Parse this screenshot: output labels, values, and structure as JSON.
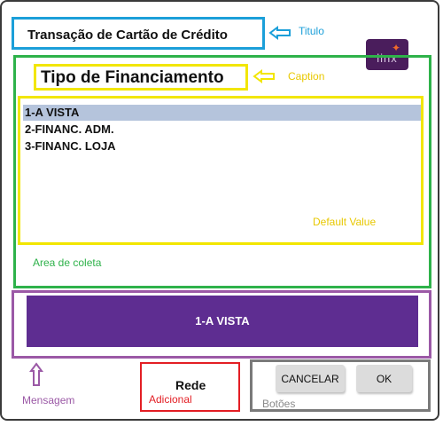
{
  "window": {
    "title": "Transação de Cartão de Crédito",
    "logo": "Linx"
  },
  "annotations": {
    "titulo": "Titulo",
    "caption": "Caption",
    "default_value": "Default Value",
    "area_coleta": "Area de coleta",
    "mensagem": "Mensagem",
    "adicional": "Adicional",
    "botoes": "Botões"
  },
  "prompt": {
    "caption": "Tipo de Financiamento",
    "options": [
      "1-A VISTA",
      "2-FINANC. ADM.",
      "3-FINANC. LOJA"
    ],
    "selected_index": 0
  },
  "value_display": "1-A VISTA",
  "rede": {
    "title": "Rede"
  },
  "buttons": {
    "cancel_label": "CANCELAR",
    "ok_label": "OK"
  },
  "colors": {
    "title_box": "#1b9fd9",
    "caption_box": "#f2e600",
    "area_box": "#2eb24a",
    "message_box": "#9b59a6",
    "value_bar": "#5e2d91",
    "rede_box": "#e31e24",
    "buttons_box": "#7a7a7a",
    "selection": "#b5c4dc"
  }
}
